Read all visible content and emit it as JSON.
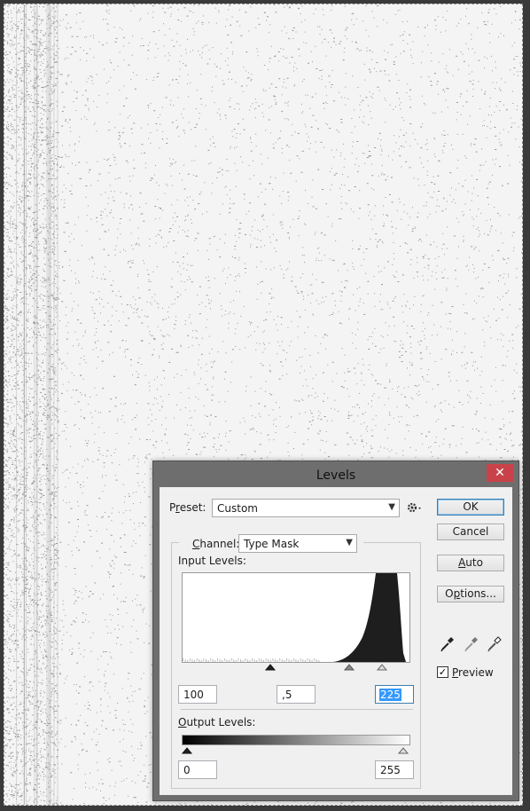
{
  "dialog": {
    "title": "Levels",
    "close_glyph": "✕",
    "preset_label": "Preset:",
    "preset_value": "Custom",
    "preset_menu_icon": "gear-icon",
    "channel_label": "Channel:",
    "channel_value": "Type Mask",
    "input_levels_label": "Input Levels:",
    "input_black": "100",
    "input_gamma": ",5",
    "input_white": "225",
    "output_levels_label": "Output Levels:",
    "output_black": "0",
    "output_white": "255",
    "buttons": {
      "ok": "OK",
      "cancel": "Cancel",
      "auto": "Auto",
      "options": "Options..."
    },
    "eyedroppers": [
      "black-point-eyedropper-icon",
      "gray-point-eyedropper-icon",
      "white-point-eyedropper-icon"
    ],
    "preview_label": "Preview",
    "preview_checked": true,
    "preview_check_glyph": "✓"
  },
  "colors": {
    "close_button": "#c9424a",
    "histogram": "#1e1e1e",
    "selection": "#3399ff"
  }
}
